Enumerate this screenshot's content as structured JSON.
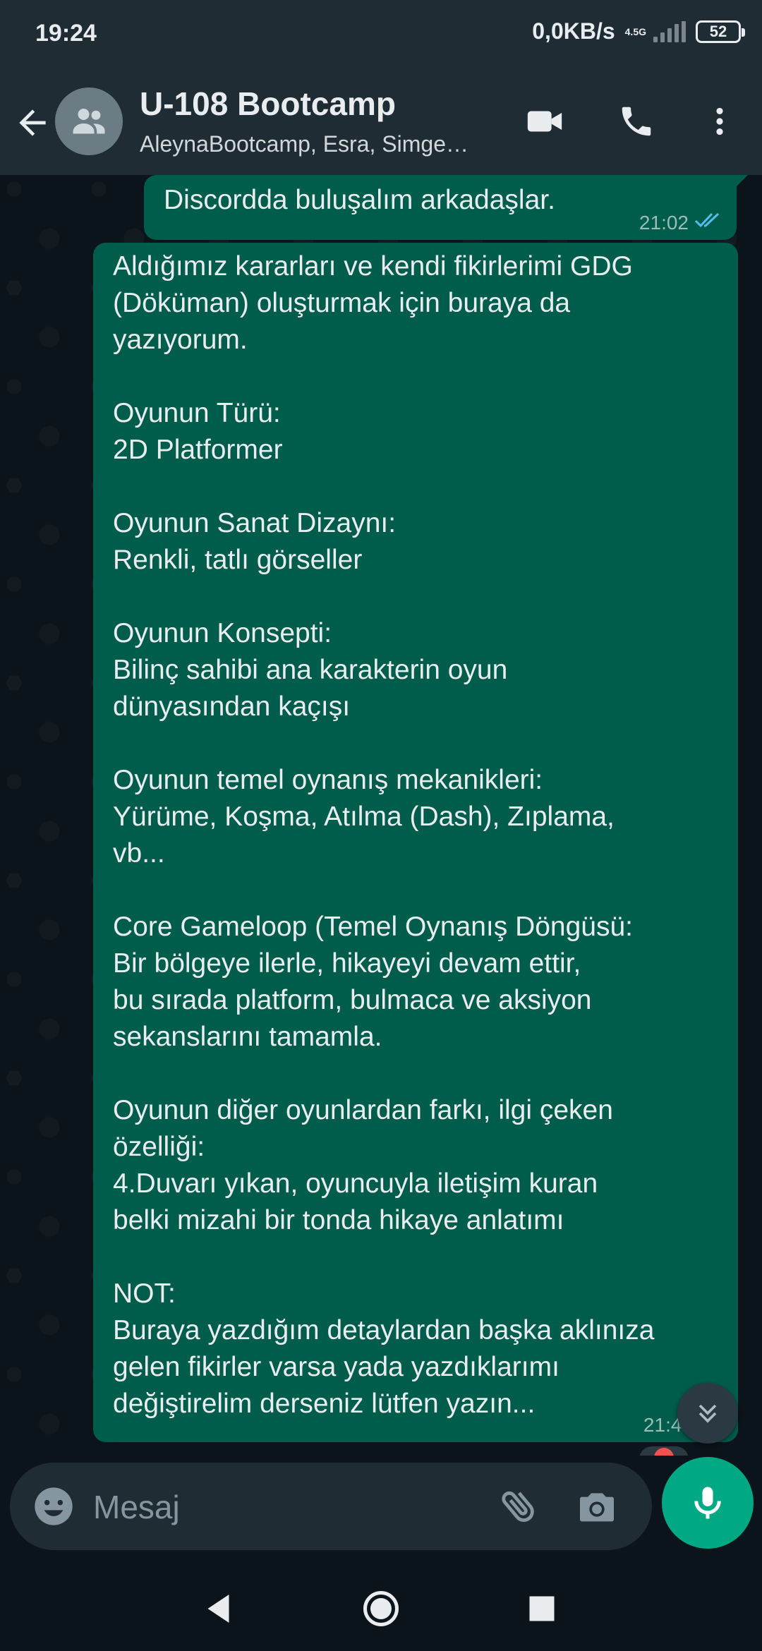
{
  "status_bar": {
    "time": "19:24",
    "net_speed": "0,0KB/s",
    "network_type": "4.5G",
    "battery": "52"
  },
  "header": {
    "title": "U-108 Bootcamp",
    "subtitle": "AleynaBootcamp, Esra, Simge…",
    "icons": [
      "back-arrow-icon",
      "group-avatar-icon",
      "video-call-icon",
      "voice-call-icon",
      "more-options-icon"
    ]
  },
  "messages": [
    {
      "text": "Discordda buluşalım arkadaşlar.",
      "time": "21:02",
      "status": "read"
    },
    {
      "text": "Aldığımız kararları ve kendi fikirlerimi GDG\n(Döküman) oluşturmak için buraya da\nyazıyorum.\n\nOyunun Türü:\n2D Platformer\n\nOyunun Sanat Dizaynı:\nRenkli, tatlı görseller\n\nOyunun Konsepti:\nBilinç sahibi ana karakterin oyun\ndünyasından kaçışı\n\nOyunun temel oynanış mekanikleri:\nYürüme, Koşma, Atılma (Dash), Zıplama,\nvb...\n\nCore Gameloop (Temel Oynanış Döngüsü:\nBir bölgeye ilerle, hikayeyi devam ettir,\nbu sırada platform, bulmaca ve aksiyon\nsekanslarını tamamla.\n\nOyunun diğer oyunlardan farkı, ilgi çeken\nözelliği:\n4.Duvarı yıkan, oyuncuyla iletişim kuran\nbelki mizahi bir tonda hikaye anlatımı\n\nNOT:\nBuraya yazdığım detaylardan başka aklınıza\ngelen fikirler varsa yada yazdıklarımı\ndeğiştirelim derseniz lütfen yazın...",
      "time": "21:45"
    }
  ],
  "input": {
    "placeholder": "Mesaj"
  },
  "colors": {
    "header_bg": "#1f2c34",
    "chat_bg": "#0b141a",
    "outgoing_bubble": "#005c4b",
    "accent": "#00a884",
    "read_ticks": "#53bdeb"
  }
}
